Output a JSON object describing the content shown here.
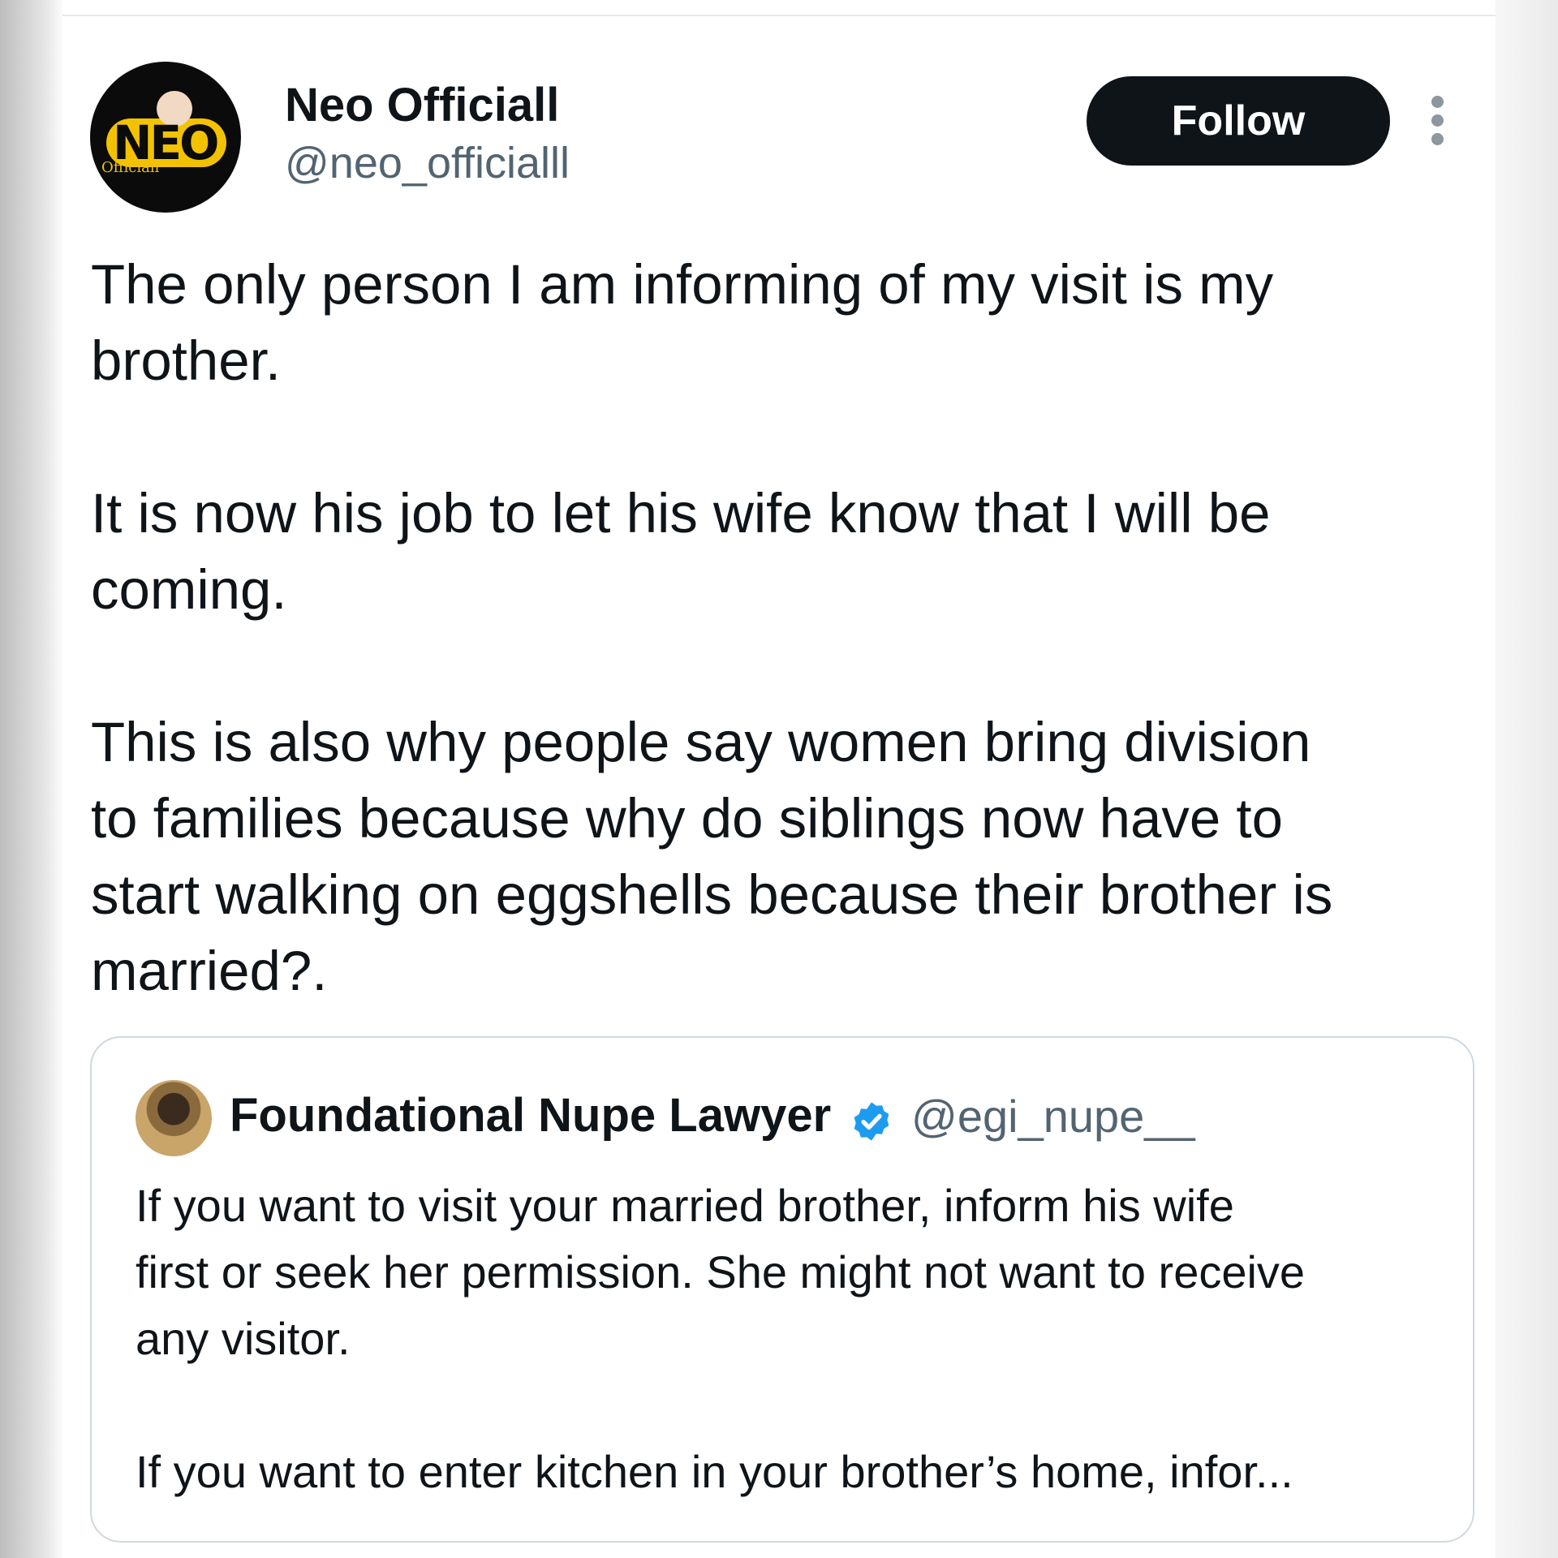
{
  "post": {
    "author": {
      "display_name": "Neo Officiall",
      "handle": "@neo_officialll",
      "avatar_logo_text": "NEO",
      "avatar_logo_subtext": "Officiall"
    },
    "follow_label": "Follow",
    "more_icon": "more-vertical-icon",
    "text": "The only person I am informing of my visit is my\nbrother.\n\nIt is now his job to let his wife know that I will be\ncoming.\n\nThis is also why people say women bring division\nto families because why do siblings now have to\nstart walking on eggshells because their brother is\nmarried?."
  },
  "quoted_post": {
    "author": {
      "display_name": "Foundational Nupe Lawyer",
      "handle": "@egi_nupe__",
      "verified_icon": "verified-badge-icon"
    },
    "text": "If you want to visit your married brother, inform his wife\nfirst or seek her permission. She might not want to receive\nany visitor.\n\nIf you want to enter kitchen in your brother’s home, infor..."
  },
  "colors": {
    "text_primary": "#0f1419",
    "text_secondary": "#536471",
    "follow_button_bg": "#0f1419",
    "verified_blue": "#1d9bf0",
    "border": "#cfd9de"
  }
}
